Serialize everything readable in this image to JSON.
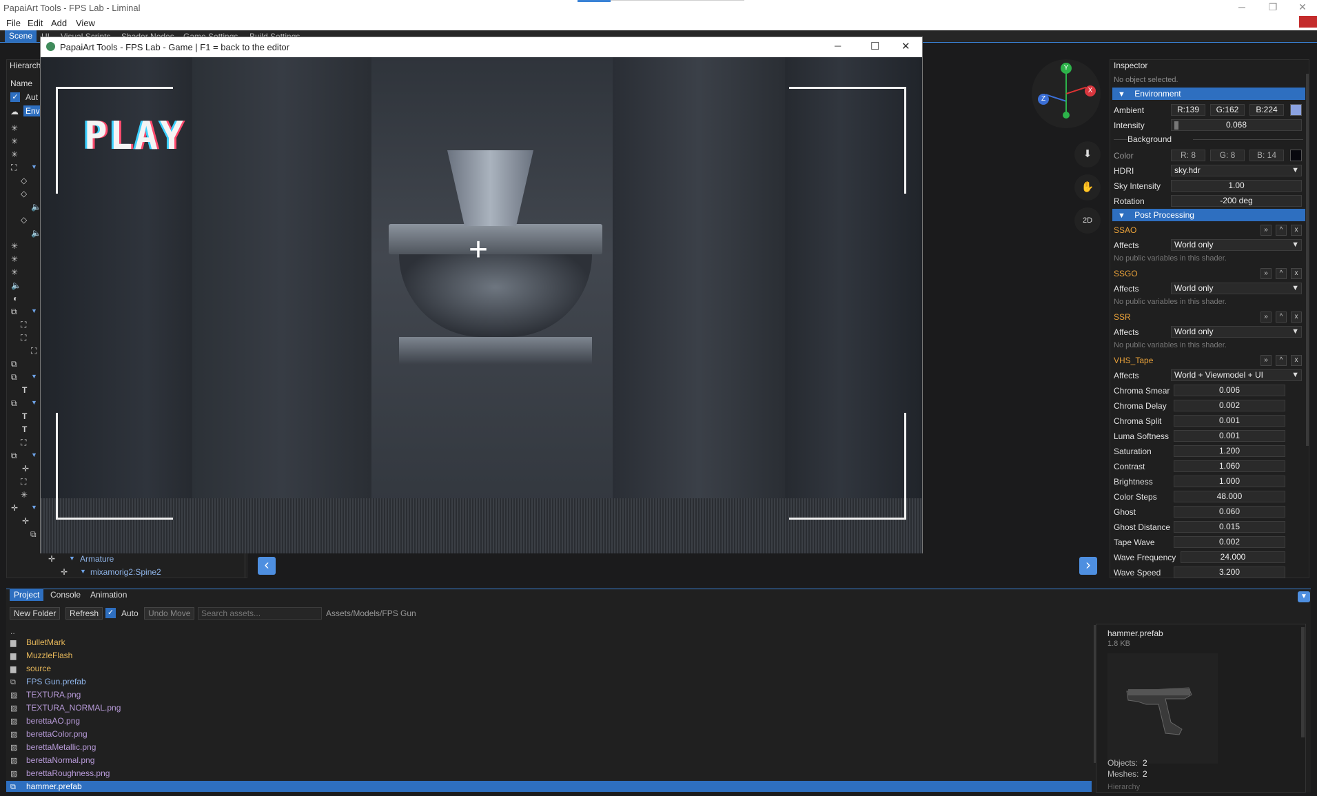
{
  "window": {
    "title": "PapaiArt Tools - FPS Lab - Liminal",
    "minimize": "─",
    "maximize": "❐",
    "close": "✕"
  },
  "menu": {
    "items": [
      "File",
      "Edit",
      "Add",
      "View"
    ]
  },
  "tabs": {
    "items": [
      "Scene",
      "UI",
      "Visual Scripts",
      "Shader Nodes",
      "Game Settings",
      "Build Settings"
    ]
  },
  "hierarchy": {
    "title": "Hierarch",
    "col_name": "Name",
    "auto": "Aut",
    "env": "Env",
    "tree_armature": "Armature",
    "tree_spine": "mixamorig2:Spine2"
  },
  "game_window": {
    "title": "PapaiArt Tools - FPS Lab - Game  |  F1 = back to the editor",
    "minimize": "─",
    "maximize": "☐",
    "close": "✕",
    "play_text": "PLAY",
    "crosshair": "+"
  },
  "gizmo": {
    "y": "Y",
    "x": "X",
    "z": "Z"
  },
  "tools": {
    "down_icon": "⬇",
    "hand_icon": "✋",
    "view2d_label": "2D",
    "prev": "‹",
    "next": "›"
  },
  "inspector": {
    "title": "Inspector",
    "no_object": "No object selected.",
    "environment_label": "Environment",
    "ambient_label": "Ambient",
    "ambient_r": "R:139",
    "ambient_g": "G:162",
    "ambient_b": "B:224",
    "ambient_color": "#8ba2e0",
    "intensity_label": "Intensity",
    "intensity_value": "0.068",
    "background_label": "Background",
    "bg_color_label": "Color",
    "bg_r": "R: 8",
    "bg_g": "G: 8",
    "bg_b": "B: 14",
    "hdri_label": "HDRI",
    "hdri_value": "sky.hdr",
    "sky_intensity_label": "Sky Intensity",
    "sky_intensity_value": "1.00",
    "rotation_label": "Rotation",
    "rotation_value": "-200 deg",
    "post_label": "Post Processing",
    "effects": [
      {
        "name": "SSAO",
        "affects_label": "Affects",
        "affects": "World only",
        "note": "No public variables in this shader."
      },
      {
        "name": "SSGO",
        "affects_label": "Affects",
        "affects": "World only",
        "note": "No public variables in this shader."
      },
      {
        "name": "SSR",
        "affects_label": "Affects",
        "affects": "World only",
        "note": "No public variables in this shader."
      },
      {
        "name": "VHS_Tape",
        "affects_label": "Affects",
        "affects": "World + Viewmodel + UI"
      }
    ],
    "fx_buttons": [
      "»",
      "^",
      "x"
    ],
    "vhs_params": [
      {
        "label": "Chroma Smear",
        "value": "0.006"
      },
      {
        "label": "Chroma Delay",
        "value": "0.002"
      },
      {
        "label": "Chroma Split",
        "value": "0.001"
      },
      {
        "label": "Luma Softness",
        "value": "0.001"
      },
      {
        "label": "Saturation",
        "value": "1.200"
      },
      {
        "label": "Contrast",
        "value": "1.060"
      },
      {
        "label": "Brightness",
        "value": "1.000"
      },
      {
        "label": "Color Steps",
        "value": "48.000"
      },
      {
        "label": "Ghost",
        "value": "0.060"
      },
      {
        "label": "Ghost Distance",
        "value": "0.015"
      },
      {
        "label": "Tape Wave",
        "value": "0.002"
      },
      {
        "label": "Wave Frequency",
        "value": "24.000"
      },
      {
        "label": "Wave Speed",
        "value": "3.200"
      }
    ]
  },
  "bottom": {
    "tabs": [
      "Project",
      "Console",
      "Animation"
    ],
    "new_folder": "New Folder",
    "refresh": "Refresh",
    "auto": "Auto",
    "undo": "Undo Move",
    "search_placeholder": "Search assets...",
    "path": "Assets/Models/FPS Gun",
    "up": "..",
    "assets": [
      {
        "name": "BulletMark",
        "kind": "folder"
      },
      {
        "name": "MuzzleFlash",
        "kind": "folder"
      },
      {
        "name": "source",
        "kind": "folder"
      },
      {
        "name": "FPS Gun.prefab",
        "kind": "prefab"
      },
      {
        "name": "TEXTURA.png",
        "kind": "image"
      },
      {
        "name": "TEXTURA_NORMAL.png",
        "kind": "image"
      },
      {
        "name": "berettaAO.png",
        "kind": "image"
      },
      {
        "name": "berettaColor.png",
        "kind": "image"
      },
      {
        "name": "berettaMetallic.png",
        "kind": "image"
      },
      {
        "name": "berettaNormal.png",
        "kind": "image"
      },
      {
        "name": "berettaRoughness.png",
        "kind": "image"
      },
      {
        "name": "hammer.prefab",
        "kind": "prefab",
        "selected": true
      }
    ],
    "preview_name": "hammer.prefab",
    "preview_size": "1.8 KB",
    "objects_label": "Objects:",
    "objects_value": "2",
    "meshes_label": "Meshes:",
    "meshes_value": "2",
    "hierarchy_label": "Hierarchy"
  }
}
